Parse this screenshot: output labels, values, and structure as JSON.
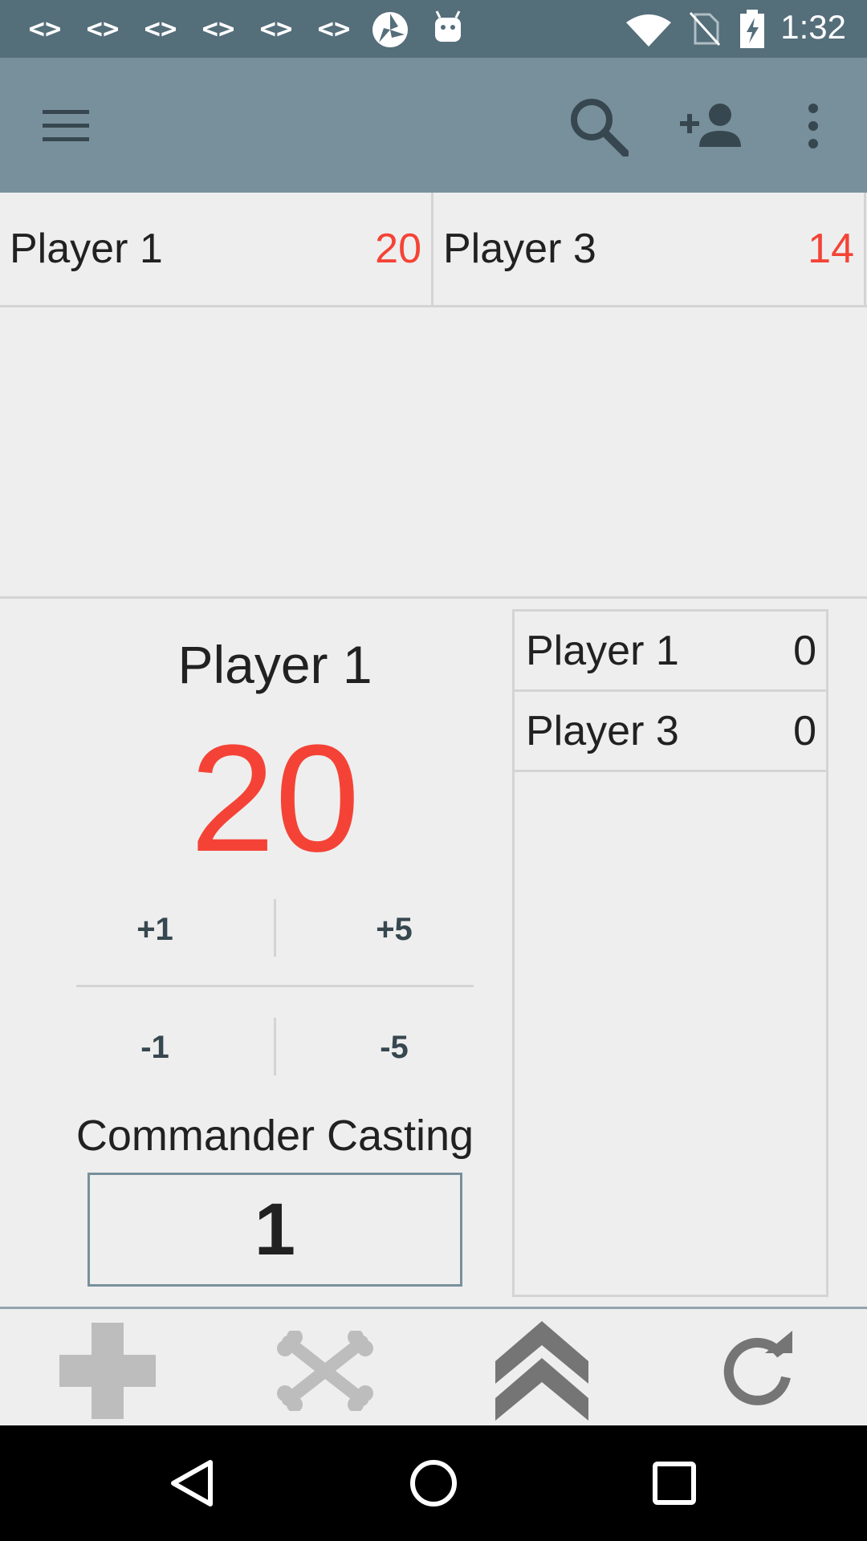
{
  "status_bar": {
    "time": "1:32",
    "notification_icons": [
      "<>",
      "<>",
      "<>",
      "<>",
      "<>",
      "<>"
    ]
  },
  "app_bar": {
    "icons": [
      "menu-icon",
      "search-icon",
      "add-person-icon",
      "more-vert-icon"
    ]
  },
  "players": [
    {
      "name": "Player 1",
      "life": "20"
    },
    {
      "name": "Player 3",
      "life": "14"
    }
  ],
  "detail": {
    "player_name": "Player 1",
    "life": "20",
    "adjust": {
      "plus1": "+1",
      "plus5": "+5",
      "minus1": "-1",
      "minus5": "-5"
    },
    "casting_label": "Commander Casting",
    "casting_value": "1"
  },
  "commander_damage": [
    {
      "name": "Player 1",
      "value": "0"
    },
    {
      "name": "Player 3",
      "value": "0"
    }
  ],
  "toolbar": {
    "icons": [
      "heal-plus-icon",
      "crossbones-icon",
      "rank-chevrons-icon",
      "reset-icon"
    ]
  },
  "colors": {
    "status_bar": "#546e7a",
    "app_bar": "#78909c",
    "life_red": "#f44336",
    "background": "#eeeeee"
  }
}
